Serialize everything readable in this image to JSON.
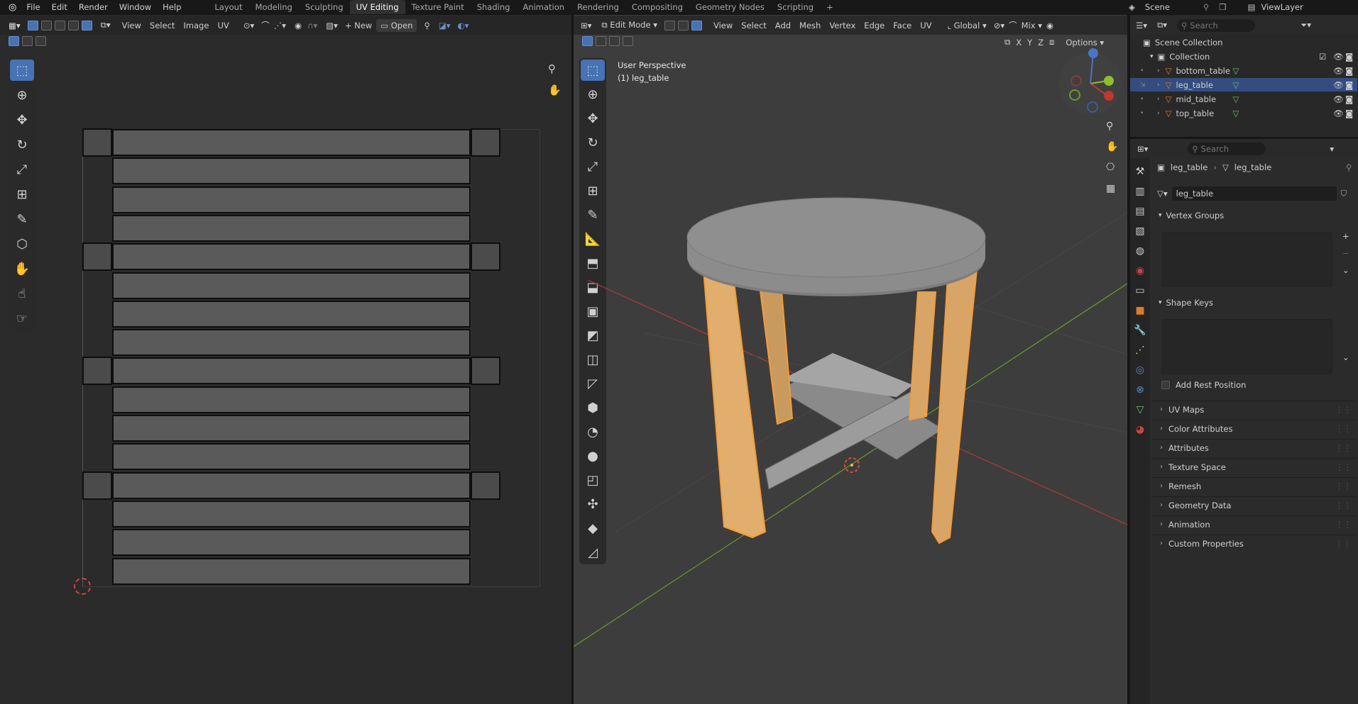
{
  "menu": [
    "File",
    "Edit",
    "Render",
    "Window",
    "Help"
  ],
  "workspaces": [
    "Layout",
    "Modeling",
    "Sculpting",
    "UV Editing",
    "Texture Paint",
    "Shading",
    "Animation",
    "Rendering",
    "Compositing",
    "Geometry Nodes",
    "Scripting"
  ],
  "active_workspace": "UV Editing",
  "scene": {
    "name": "Scene",
    "view_layer": "ViewLayer"
  },
  "uv_editor": {
    "menu": [
      "View",
      "Select",
      "Image",
      "UV"
    ],
    "new_label": "New",
    "open_label": "Open"
  },
  "viewport": {
    "mode": "Edit Mode",
    "menu": [
      "View",
      "Select",
      "Add",
      "Mesh",
      "Vertex",
      "Edge",
      "Face",
      "UV"
    ],
    "transform": "Global",
    "shading": "Mix",
    "options_label": "Options",
    "axes": [
      "X",
      "Y",
      "Z"
    ],
    "perspective_label": "User Perspective",
    "object_label": "(1) leg_table"
  },
  "outliner": {
    "search_placeholder": "Search",
    "scene_collection": "Scene Collection",
    "collection": "Collection",
    "items": [
      {
        "name": "bottom_table",
        "selected": false
      },
      {
        "name": "leg_table",
        "selected": true
      },
      {
        "name": "mid_table",
        "selected": false
      },
      {
        "name": "top_table",
        "selected": false
      }
    ]
  },
  "properties": {
    "search_placeholder": "Search",
    "breadcrumb": [
      "leg_table",
      "leg_table"
    ],
    "mesh_name": "leg_table",
    "vertex_groups": "Vertex Groups",
    "shape_keys": "Shape Keys",
    "add_rest_position": "Add Rest Position",
    "panels": [
      "UV Maps",
      "Color Attributes",
      "Attributes",
      "Texture Space",
      "Remesh",
      "Geometry Data",
      "Animation",
      "Custom Properties"
    ]
  },
  "colors": {
    "accent": "#4772b3",
    "selection": "#f39c3a",
    "x_axis": "#c0392b",
    "y_axis": "#6a9a2a"
  }
}
